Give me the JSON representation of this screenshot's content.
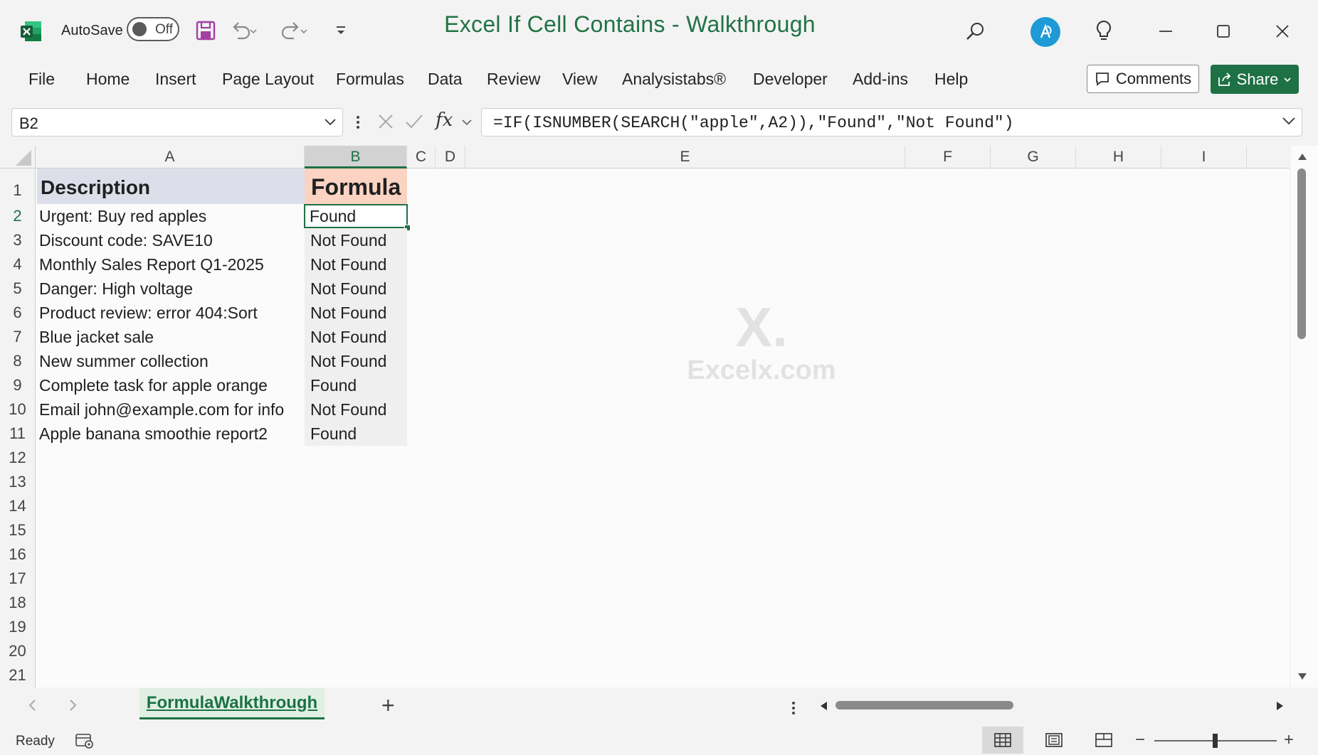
{
  "window": {
    "title": "Excel If Cell Contains - Walkthrough",
    "autosave_label": "AutoSave",
    "autosave_state": "Off"
  },
  "ribbon": {
    "tabs": [
      "File",
      "Home",
      "Insert",
      "Page Layout",
      "Formulas",
      "Data",
      "Review",
      "View",
      "Analysistabs®",
      "Developer",
      "Add-ins",
      "Help"
    ],
    "comments_label": "Comments",
    "share_label": "Share"
  },
  "formula_bar": {
    "name_box": "B2",
    "fx_label": "fx",
    "formula": "=IF(ISNUMBER(SEARCH(\"apple\",A2)),\"Found\",\"Not Found\")"
  },
  "grid": {
    "columns": [
      "A",
      "B",
      "C",
      "D",
      "E",
      "F",
      "G",
      "H",
      "I"
    ],
    "selected_column": "B",
    "row_numbers": [
      "1",
      "2",
      "3",
      "4",
      "5",
      "6",
      "7",
      "8",
      "9",
      "10",
      "11",
      "12",
      "13",
      "14",
      "15",
      "16",
      "17",
      "18",
      "19",
      "20",
      "21"
    ],
    "selected_row": "2",
    "header": {
      "a": "Description",
      "b": "Formula"
    },
    "rows": [
      {
        "a": "Urgent: Buy red apples",
        "b": "Found"
      },
      {
        "a": "Discount code: SAVE10",
        "b": "Not Found"
      },
      {
        "a": "Monthly Sales Report Q1-2025",
        "b": "Not Found"
      },
      {
        "a": "Danger: High voltage",
        "b": "Not Found"
      },
      {
        "a": "Product review: error 404:Sort",
        "b": "Not Found"
      },
      {
        "a": "Blue jacket sale",
        "b": "Not Found"
      },
      {
        "a": "New summer collection",
        "b": "Not Found"
      },
      {
        "a": "Complete task for apple orange",
        "b": "Found"
      },
      {
        "a": "Email john@example.com for info",
        "b": "Not Found"
      },
      {
        "a": "Apple banana smoothie report2",
        "b": "Found"
      }
    ]
  },
  "watermark": {
    "logo": "X.",
    "text": "Excelx.com"
  },
  "sheets": {
    "active": "FormulaWalkthrough",
    "add_label": "+"
  },
  "status": {
    "text": "Ready",
    "zoom_minus": "−",
    "zoom_plus": "+"
  },
  "colors": {
    "accent": "#1e7145",
    "header_a_fill": "#dcdfe9",
    "header_b_fill": "#fad3c3",
    "excel_green": "#217346"
  }
}
